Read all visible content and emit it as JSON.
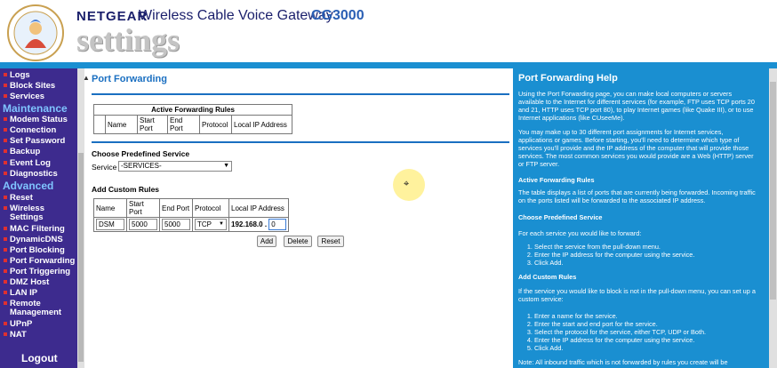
{
  "header": {
    "brand": "NETGEAR",
    "product": "Wireless Cable Voice Gateway",
    "model": "CG3000",
    "settings_word": "settings"
  },
  "sidebar": {
    "items_top": [
      "Logs",
      "Block Sites",
      "Services"
    ],
    "maintenance_heading": "Maintenance",
    "items_maintenance": [
      "Modem Status",
      "Connection",
      "Set Password",
      "Backup",
      "Event Log",
      "Diagnostics"
    ],
    "advanced_heading": "Advanced",
    "items_advanced": [
      "Reset",
      "Wireless Settings",
      "MAC Filtering",
      "DynamicDNS",
      "Port Blocking",
      "Port Forwarding",
      "Port Triggering",
      "DMZ Host",
      "LAN IP",
      "Remote Management",
      "UPnP",
      "NAT"
    ],
    "logout": "Logout"
  },
  "main": {
    "title": "Port Forwarding",
    "active_rules_title": "Active Forwarding Rules",
    "active_columns": [
      "",
      "Name",
      "Start Port",
      "End Port",
      "Protocol",
      "Local IP Address"
    ],
    "predefined_title": "Choose Predefined Service",
    "service_label": "Service",
    "service_selected": "-SERVICES-",
    "custom_title": "Add Custom Rules",
    "custom_columns": [
      "Name",
      "Start Port",
      "End Port",
      "Protocol",
      "Local IP Address"
    ],
    "custom_values": {
      "name": "DSM",
      "start_port": "5000",
      "end_port": "5000",
      "protocol": "TCP",
      "ip_prefix": "192.168.0 .",
      "ip_last": "0"
    },
    "buttons": {
      "add": "Add",
      "delete": "Delete",
      "reset": "Reset"
    }
  },
  "help": {
    "title": "Port Forwarding Help",
    "p1": "Using the Port Forwarding page, you can make local computers or servers available to the Internet for different services (for example, FTP uses TCP ports 20 and 21, HTTP uses TCP port 80), to play Internet games (like Quake III), or to use Internet applications (like CUseeMe).",
    "p2": "You may make up to 30 different port assignments for Internet services, applications or games. Before starting, you'll need to determine which type of services you'll provide and the IP address of the computer that will provide those services. The most common services you would provide are a Web (HTTP) server or FTP server.",
    "h_active": "Active Forwarding Rules",
    "p3": "The table displays a list of ports that are currently being forwarded. Incoming traffic on the ports listed will be forwarded to the associated IP address.",
    "h_predefined": "Choose Predefined Service",
    "p4": "For each service you would like to forward:",
    "list1": [
      "Select the service from the pull-down menu.",
      "Enter the IP address for the computer using the service.",
      "Click Add."
    ],
    "h_custom": "Add Custom Rules",
    "p5": "If the service you would like to block is not in the pull-down menu, you can set up a custom service:",
    "list2": [
      "Enter a name for the service.",
      "Enter the start and end port for the service.",
      "Select the protocol for the service, either TCP, UDP or Both.",
      "Enter the IP address for the computer using the service.",
      "Click Add."
    ],
    "note": "Note: All inbound traffic which is not forwarded by rules you create will be"
  },
  "colors": {
    "sidebar_bg": "#3d2b8e",
    "accent_blue": "#1a8fd1",
    "title_blue": "#1a6fc1"
  }
}
